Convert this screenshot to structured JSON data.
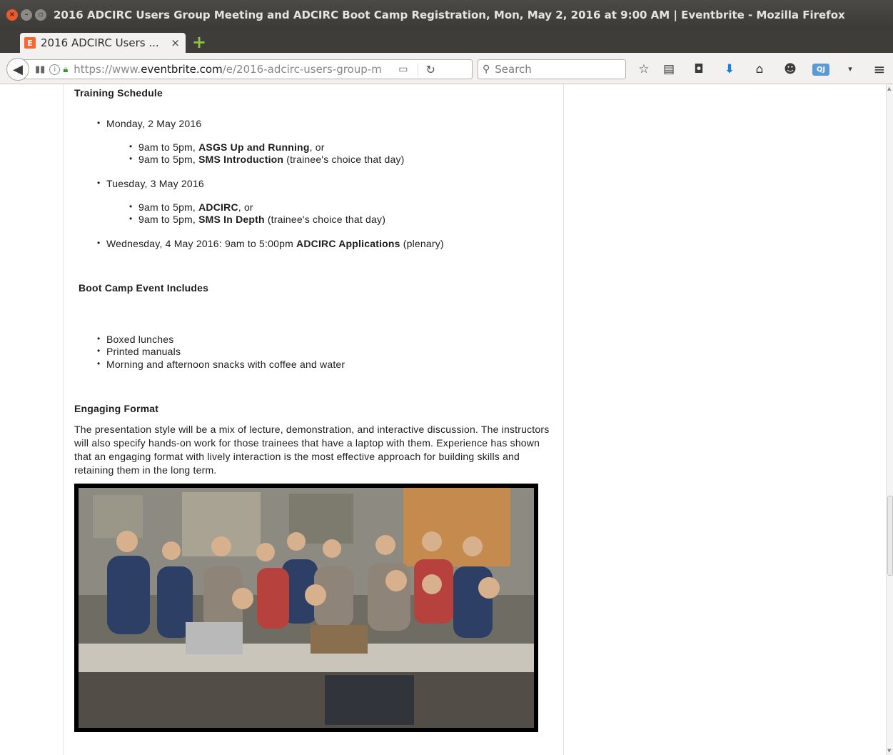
{
  "window": {
    "title": "2016 ADCIRC Users Group Meeting and ADCIRC Boot Camp Registration, Mon, May 2, 2016 at 9:00 AM | Eventbrite - Mozilla Firefox"
  },
  "tab": {
    "label": "2016 ADCIRC Users ...",
    "favicon": "E",
    "close": "×",
    "new_tab": "+"
  },
  "navbar": {
    "url_scheme": "https://www.",
    "url_host": "eventbrite.com",
    "url_path": "/e/2016-adcirc-users-group-m",
    "search_placeholder": "Search",
    "qj_label": "QJ"
  },
  "content": {
    "training_heading": "Training Schedule",
    "days": [
      {
        "label": "Monday, 2 May 2016",
        "sessions": [
          {
            "time": "9am to 5pm, ",
            "name": "ASGS Up and Running",
            "suffix": ", or"
          },
          {
            "time": "9am to 5pm, ",
            "name": "SMS Introduction",
            "suffix": " (trainee's choice that day)"
          }
        ]
      },
      {
        "label": "Tuesday, 3 May 2016",
        "sessions": [
          {
            "time": "9am to 5pm, ",
            "name": "ADCIRC",
            "suffix": ", or"
          },
          {
            "time": "9am to 5pm, ",
            "name": "SMS In Depth",
            "suffix": " (trainee's choice that day)"
          }
        ]
      }
    ],
    "wednesday": {
      "prefix": "Wednesday, 4 May 2016: 9am to 5:00pm ",
      "name": "ADCIRC Applications",
      "suffix": " (plenary)"
    },
    "bootcamp_heading": "Boot Camp Event Includes",
    "includes": [
      "Boxed lunches",
      "Printed manuals",
      "Morning and afternoon snacks with coffee and water"
    ],
    "format_heading": "Engaging Format",
    "format_text": "The presentation style will be a mix of lecture, demonstration, and interactive discussion. The instructors will also specify hands-on work for those trainees that have a laptop with them. Experience has shown that an engaging format with lively interaction is the most effective approach for building skills and retaining them in the long term."
  },
  "colors": {
    "titlebar": "#3b3a37",
    "toolbar": "#f2f1f0",
    "eventbrite_orange": "#f6682f",
    "lock_green": "#2d9f1e",
    "download_blue": "#1f7fe0"
  },
  "icons": [
    "close-icon",
    "minimize-icon",
    "maximize-icon",
    "back-arrow-icon",
    "identity-icon",
    "info-icon",
    "lock-icon",
    "reader-view-icon",
    "reload-icon",
    "search-icon",
    "bookmark-star-icon",
    "reading-list-icon",
    "pocket-icon",
    "download-icon",
    "home-icon",
    "chat-icon",
    "menu-icon"
  ]
}
